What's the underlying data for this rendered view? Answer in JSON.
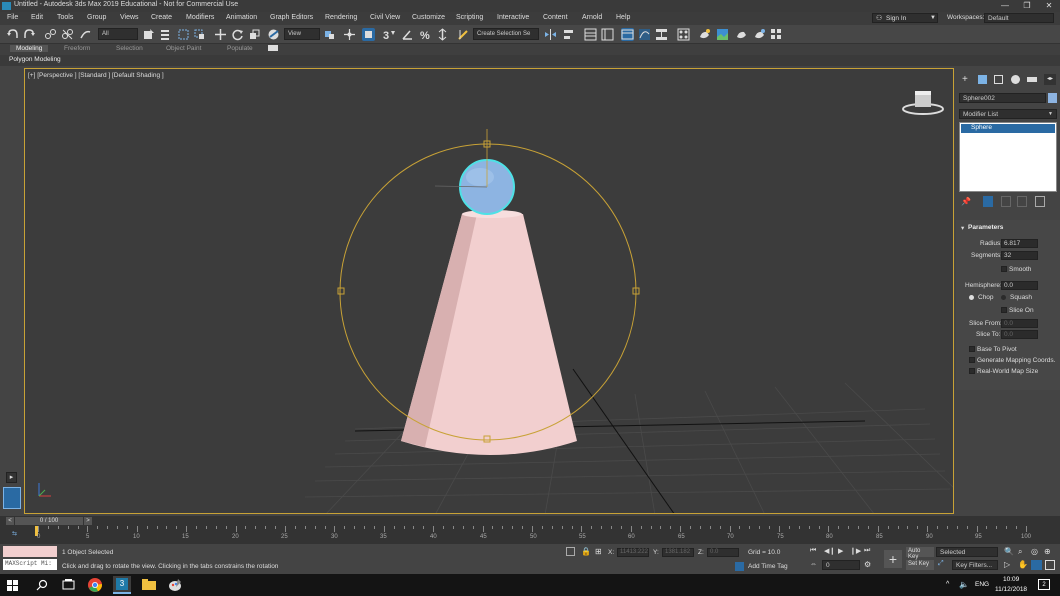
{
  "window": {
    "title": "Untitled - Autodesk 3ds Max 2019 Educational - Not for Commercial Use",
    "min": "—",
    "max": "❐",
    "close": "✕"
  },
  "menu": {
    "items": [
      "File",
      "Edit",
      "Tools",
      "Group",
      "Views",
      "Create",
      "Modifiers",
      "Animation",
      "Graph Editors",
      "Rendering",
      "Civil View",
      "Customize",
      "Scripting",
      "Interactive",
      "Content",
      "Arnold",
      "Help"
    ],
    "sign_in": "Sign In",
    "workspaces_label": "Workspaces:",
    "workspace_value": "Default"
  },
  "toolbar": {
    "filter_value": "All",
    "refcoord_value": "View",
    "selection_set_placeholder": "Create Selection Se"
  },
  "ribbon": {
    "tabs": [
      "Modeling",
      "Freeform",
      "Selection",
      "Object Paint",
      "Populate"
    ],
    "sub_label": "Polygon Modeling"
  },
  "viewport": {
    "label": "[+] [Perspective ] [Standard ] [Default Shading ]"
  },
  "command_panel": {
    "object_name": "Sphere002",
    "modifier_list": "Modifier List",
    "stack_item": "Sphere",
    "rollout_title": "Parameters",
    "radius_label": "Radius:",
    "radius_value": "6.817",
    "segments_label": "Segments:",
    "segments_value": "32",
    "smooth_label": "Smooth",
    "hemisphere_label": "Hemisphere:",
    "hemisphere_value": "0.0",
    "chop_label": "Chop",
    "squash_label": "Squash",
    "slice_on_label": "Slice On",
    "slice_from_label": "Slice From:",
    "slice_from_value": "0.0",
    "slice_to_label": "Slice To:",
    "slice_to_value": "0.0",
    "base_to_pivot_label": "Base To Pivot",
    "gen_mapping_label": "Generate Mapping Coords.",
    "real_world_label": "Real-World Map Size"
  },
  "timeline": {
    "frame_display": "0 / 100",
    "ticks": [
      "0",
      "5",
      "10",
      "15",
      "20",
      "25",
      "30",
      "35",
      "40",
      "45",
      "50",
      "55",
      "60",
      "65",
      "70",
      "75",
      "80",
      "85",
      "90",
      "95",
      "100"
    ]
  },
  "status": {
    "selected": "1 Object Selected",
    "prompt": "Click and drag to rotate the view.  Clicking in the tabs constrains the rotation",
    "maxscript": "MAXScript Mi:",
    "x_label": "X:",
    "x_value": "11413.222",
    "y_label": "Y:",
    "y_value": "1381.182",
    "z_label": "Z:",
    "z_value": "0.0",
    "grid": "Grid = 10.0",
    "add_time_tag": "Add Time Tag",
    "frame_value": "0",
    "auto_key": "Auto Key",
    "set_key": "Set Key",
    "key_mode_value": "Selected",
    "key_filters": "Key Filters..."
  },
  "taskbar": {
    "lang": "ENG",
    "time": "10:09",
    "date": "11/12/2018",
    "notif_count": "2"
  },
  "colors": {
    "accent": "#2a6aa3",
    "viewport_border": "#c8a236",
    "cone": "#f2cfcf",
    "sphere": "#8db4e2",
    "sphere_outline": "#4ee1e6",
    "gizmo": "#c8a236"
  }
}
